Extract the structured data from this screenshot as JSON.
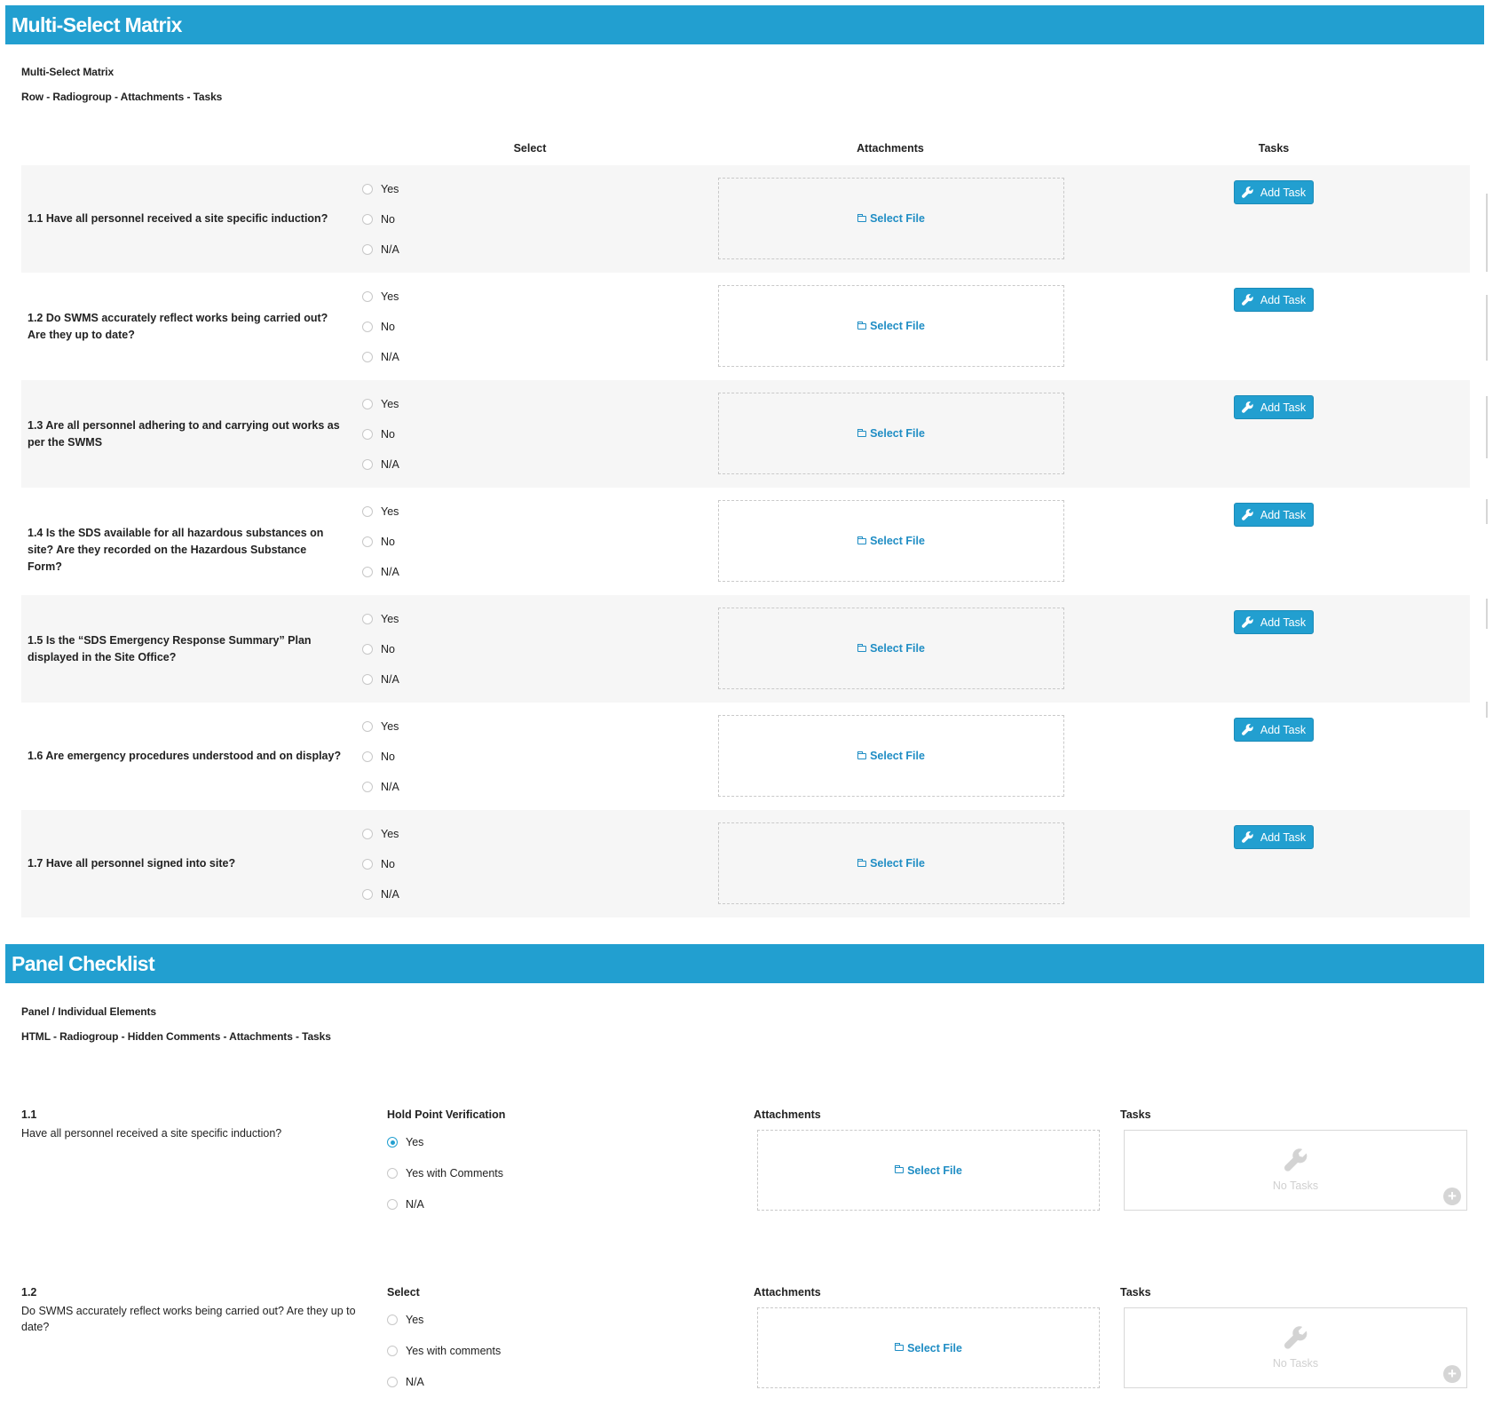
{
  "matrix_section": {
    "title": "Multi-Select Matrix",
    "subtitle": "Multi-Select Matrix",
    "description": "Row - Radiogroup - Attachments - Tasks",
    "columns": {
      "select": "Select",
      "attachments": "Attachments",
      "tasks": "Tasks"
    },
    "options": [
      "Yes",
      "No",
      "N/A"
    ],
    "select_file_label": "Select File",
    "add_task_label": "Add Task",
    "rows": [
      {
        "question": "1.1 Have all personnel received a site specific induction?"
      },
      {
        "question": "1.2 Do SWMS accurately reflect works being carried out? Are they up to date?"
      },
      {
        "question": "1.3 Are all personnel adhering to and carrying out works as per the SWMS"
      },
      {
        "question": "1.4 Is the SDS available for all hazardous substances on site? Are they recorded on the Hazardous Substance Form?"
      },
      {
        "question": "1.5 Is the “SDS Emergency Response Summary” Plan displayed in the Site Office?"
      },
      {
        "question": "1.6 Are emergency procedures understood and on display?"
      },
      {
        "question": "1.7 Have all personnel signed into site?"
      }
    ]
  },
  "panel_section": {
    "title": "Panel Checklist",
    "subtitle": "Panel / Individual Elements",
    "description": "HTML - Radiogroup - Hidden Comments - Attachments - Tasks",
    "select_file_label": "Select File",
    "no_tasks_label": "No Tasks",
    "attachments_label": "Attachments",
    "tasks_label": "Tasks",
    "items": [
      {
        "number": "1.1",
        "question": "Have all personnel received a site specific induction?",
        "group_label": "Hold Point Verification",
        "options": [
          "Yes",
          "Yes with Comments",
          "N/A"
        ],
        "selected": "Yes"
      },
      {
        "number": "1.2",
        "question": "Do SWMS accurately reflect works being carried out? Are they up to date?",
        "group_label": "Select",
        "options": [
          "Yes",
          "Yes with comments",
          "N/A"
        ],
        "selected": ""
      }
    ]
  },
  "colors": {
    "accent": "#229fd0",
    "link": "#1f8dc4",
    "row_shade": "#f6f6f6"
  }
}
